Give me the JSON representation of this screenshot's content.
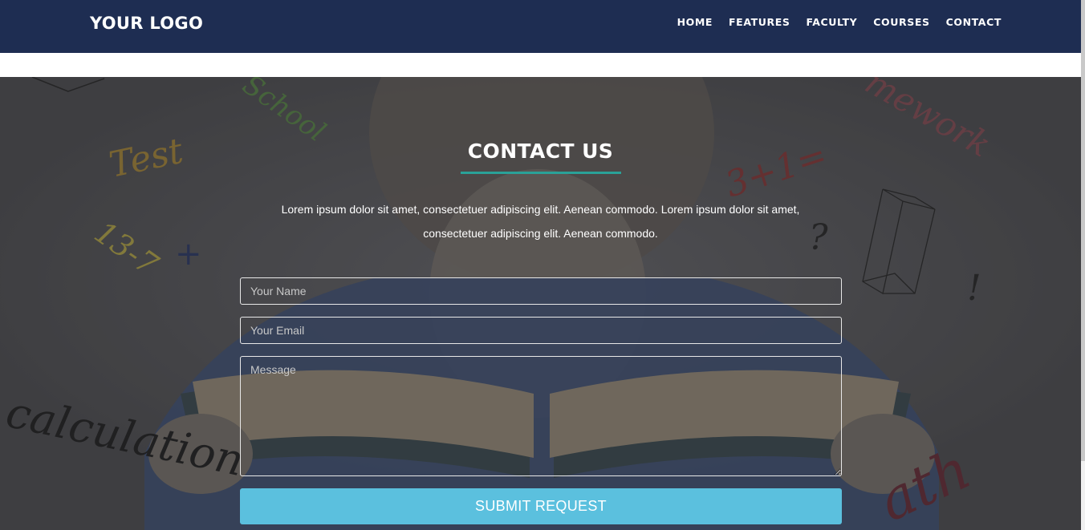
{
  "header": {
    "logo": "YOUR LOGO",
    "nav": [
      {
        "label": "HOME"
      },
      {
        "label": "FEATURES"
      },
      {
        "label": "FACULTY"
      },
      {
        "label": "COURSES"
      },
      {
        "label": "CONTACT"
      }
    ],
    "background_color": "#1e2d52"
  },
  "contact": {
    "title": "CONTACT US",
    "accent_color": "#2aa198",
    "intro_line1": "Lorem ipsum dolor sit amet, consectetuer adipiscing elit. Aenean commodo. Lorem ipsum dolor sit amet,",
    "intro_line2": "consectetuer adipiscing elit. Aenean commodo.",
    "form": {
      "name_placeholder": "Your Name",
      "email_placeholder": "Your Email",
      "message_placeholder": "Message",
      "submit_label": "SUBMIT REQUEST",
      "submit_color": "#5bc0de"
    }
  },
  "background_doodles": {
    "words": [
      "Test",
      "School",
      "mework",
      "calculation",
      "ath"
    ],
    "math": [
      "3+1=",
      "13-7",
      "+",
      "?",
      "!"
    ]
  }
}
